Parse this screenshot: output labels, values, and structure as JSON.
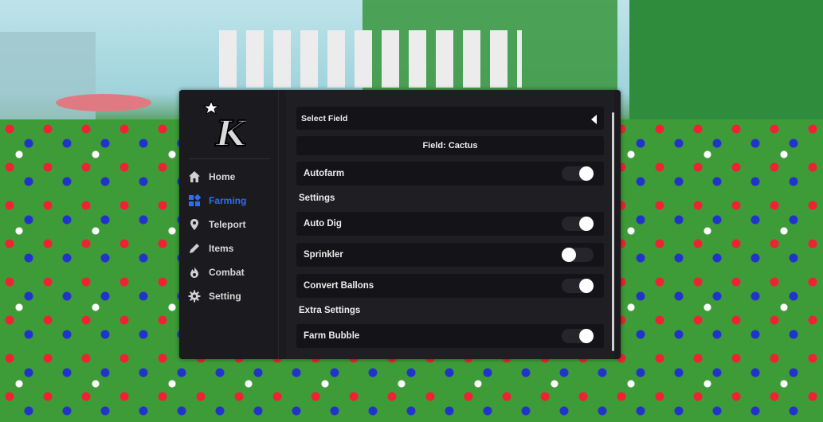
{
  "sidebar": {
    "logo_letter": "K",
    "items": [
      {
        "label": "Home",
        "icon": "home-icon",
        "active": false
      },
      {
        "label": "Farming",
        "icon": "map-icon",
        "active": true
      },
      {
        "label": "Teleport",
        "icon": "location-pin-icon",
        "active": false
      },
      {
        "label": "Items",
        "icon": "pencil-icon",
        "active": false
      },
      {
        "label": "Combat",
        "icon": "fire-icon",
        "active": false
      },
      {
        "label": "Setting",
        "icon": "gear-icon",
        "active": false
      }
    ]
  },
  "content": {
    "select_field": {
      "label": "Select Field",
      "icon": "triangle-left-icon"
    },
    "field_display": "Field: Cactus",
    "autofarm": {
      "label": "Autofarm",
      "on": true
    },
    "settings_title": "Settings",
    "settings": [
      {
        "label": "Auto Dig",
        "on": true
      },
      {
        "label": "Sprinkler",
        "on": false
      },
      {
        "label": "Convert Ballons",
        "on": true
      }
    ],
    "extra_title": "Extra Settings",
    "extra": [
      {
        "label": "Farm Bubble",
        "on": true
      }
    ]
  },
  "colors": {
    "panel_bg": "#1b1b1f",
    "row_bg": "#141418",
    "accent_blue": "#2f6df0",
    "toggle_track": "#25252b",
    "toggle_knob": "#ffffff"
  }
}
